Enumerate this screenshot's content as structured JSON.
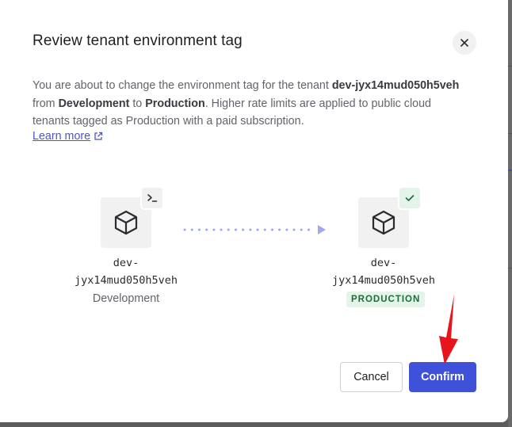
{
  "dialog": {
    "title": "Review tenant environment tag",
    "close_icon": "close-icon",
    "description": {
      "intro": "You are about to change the environment tag for the tenant ",
      "tenant": "dev-jyx14mud050h5veh",
      "from_word": " from ",
      "from_env": "Development",
      "to_word": " to ",
      "to_env": "Production",
      "outro": ". Higher rate limits are applied to public cloud tenants tagged as Production with a paid subscription."
    },
    "learn_more": "Learn more",
    "learn_more_icon": "external-link-icon"
  },
  "source": {
    "name_line1": "dev-",
    "name_line2": "jyx14mud050h5veh",
    "environment": "Development",
    "icon": "cube-icon",
    "badge_icon": "terminal-icon"
  },
  "target": {
    "name_line1": "dev-",
    "name_line2": "jyx14mud050h5veh",
    "environment_tag": "PRODUCTION",
    "icon": "cube-icon",
    "badge_icon": "check-icon"
  },
  "buttons": {
    "cancel": "Cancel",
    "confirm": "Confirm"
  },
  "colors": {
    "primary": "#3f51d9",
    "connector": "#9fa8f0",
    "annotation": "#e8141b",
    "production_bg": "#e4f4e8",
    "production_text": "#1f6b3a"
  }
}
